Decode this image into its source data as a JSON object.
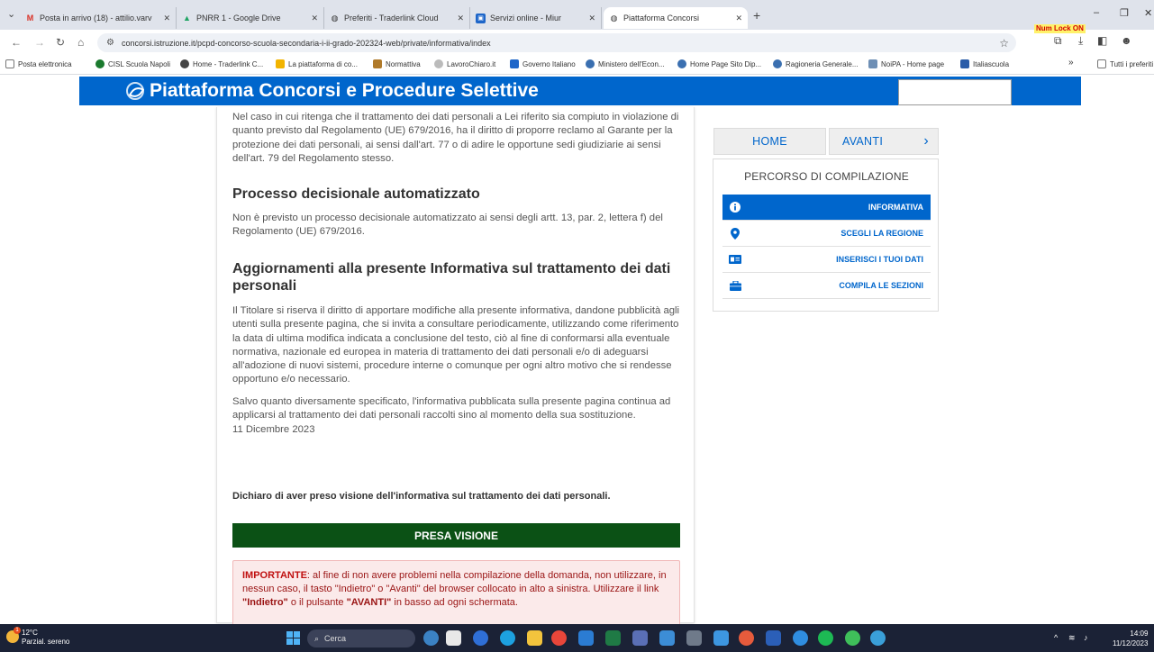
{
  "browser": {
    "tabs": [
      {
        "label": "Posta in arrivo (18) - attilio.varv",
        "icon": "gmail-icon",
        "color": "#d93025"
      },
      {
        "label": "PNRR 1 - Google Drive",
        "icon": "drive-icon",
        "color": "#1fa463"
      },
      {
        "label": "Preferiti - Traderlink Cloud",
        "icon": "globe-icon",
        "color": "#555555"
      },
      {
        "label": "Servizi online - Miur",
        "icon": "miur-icon",
        "color": "#1e66c9"
      },
      {
        "label": "Piattaforma Concorsi",
        "icon": "globe-icon",
        "color": "#555555"
      }
    ],
    "new_tab": "+",
    "url": "concorsi.istruzione.it/pcpd-concorso-scuola-secondaria-i-ii-grado-202324-web/private/informativa/index",
    "numlock": "Num Lock ON",
    "bookmarks": [
      {
        "label": "Posta elettronica",
        "color": "#7a7a7a"
      },
      {
        "label": "CISL Scuola Napoli",
        "color": "#1a7a2e"
      },
      {
        "label": "Home - Traderlink C...",
        "color": "#444444"
      },
      {
        "label": "La piattaforma di co...",
        "color": "#f2b400"
      },
      {
        "label": "Normattiva",
        "color": "#b07a2a"
      },
      {
        "label": "LavoroChiaro.it",
        "color": "#777777"
      },
      {
        "label": "Governo Italiano",
        "color": "#1e66c9"
      },
      {
        "label": "Ministero dell'Econ...",
        "color": "#3a6fb0"
      },
      {
        "label": "Home Page Sito Dip...",
        "color": "#3a6fb0"
      },
      {
        "label": "Ragioneria Generale...",
        "color": "#3a6fb0"
      },
      {
        "label": "NoiPA - Home page",
        "color": "#6e8fb5"
      },
      {
        "label": "Italiascuola",
        "color": "#2a5ca8"
      }
    ],
    "bookmarks_more": "»",
    "all_bookmarks": "Tutti i preferiti"
  },
  "header": {
    "title": "Piattaforma Concorsi e Procedure Selettive"
  },
  "content": {
    "para_reclamo": "Nel caso in cui ritenga che il trattamento dei dati personali a Lei riferito sia compiuto in violazione di quanto previsto dal Regolamento (UE) 679/2016, ha il diritto di proporre reclamo al Garante per la protezione dei dati personali, ai sensi dall'art. 77 o di adire le opportune sedi giudiziarie ai sensi dell'art. 79 del Regolamento stesso.",
    "heading_processo": "Processo decisionale automatizzato",
    "para_processo": "Non è previsto un processo decisionale automatizzato ai sensi degli artt. 13, par. 2, lettera f) del Regolamento (UE) 679/2016.",
    "heading_aggiornamenti": "Aggiornamenti alla presente Informativa sul trattamento dei dati personali",
    "para_titolare": "Il Titolare si riserva il diritto di apportare modifiche alla presente informativa, dandone pubblicità agli utenti sulla presente pagina, che si invita a consultare periodicamente, utilizzando come riferimento la data di ultima modifica indicata a conclusione del testo, ciò al fine di conformarsi alla eventuale normativa, nazionale ed europea in materia di trattamento dei dati personali e/o di adeguarsi all'adozione di nuovi sistemi, procedure interne o comunque per ogni altro motivo che si rendesse opportuno e/o necessario.",
    "para_salvo": "Salvo quanto diversamente specificato, l'informativa pubblicata sulla presente pagina continua ad applicarsi al trattamento dei dati personali raccolti sino al momento della sua sostituzione.",
    "date": "11 Dicembre 2023",
    "declaration": "Dichiaro di aver preso visione dell'informativa sul trattamento dei dati personali.",
    "presa_visione": "PRESA VISIONE",
    "alert": {
      "label": "IMPORTANTE",
      "text1": ": al fine di non avere problemi nella compilazione della domanda, non utilizzare, in nessun caso, il tasto \"Indietro\" o \"Avanti\" del browser collocato in alto a sinistra. Utilizzare il link ",
      "link_indietro": "\"Indietro\"",
      "text2": " o il pulsante ",
      "btn_avanti": "\"AVANTI\"",
      "text3": " in basso ad ogni schermata."
    }
  },
  "sidebar": {
    "home": "HOME",
    "avanti": "AVANTI",
    "avanti_arrow": "›",
    "panel_title": "PERCORSO DI COMPILAZIONE",
    "steps": [
      {
        "label": "INFORMATIVA",
        "icon": "info-icon",
        "active": true
      },
      {
        "label": "SCEGLI LA REGIONE",
        "icon": "map-pin-icon",
        "active": false
      },
      {
        "label": "INSERISCI I TUOI DATI",
        "icon": "id-card-icon",
        "active": false
      },
      {
        "label": "COMPILA LE SEZIONI",
        "icon": "briefcase-icon",
        "active": false
      }
    ]
  },
  "taskbar": {
    "temp": "12°C",
    "weather": "Parzial. sereno",
    "search_placeholder": "Cerca",
    "time": "14:09",
    "date": "11/12/2023"
  }
}
